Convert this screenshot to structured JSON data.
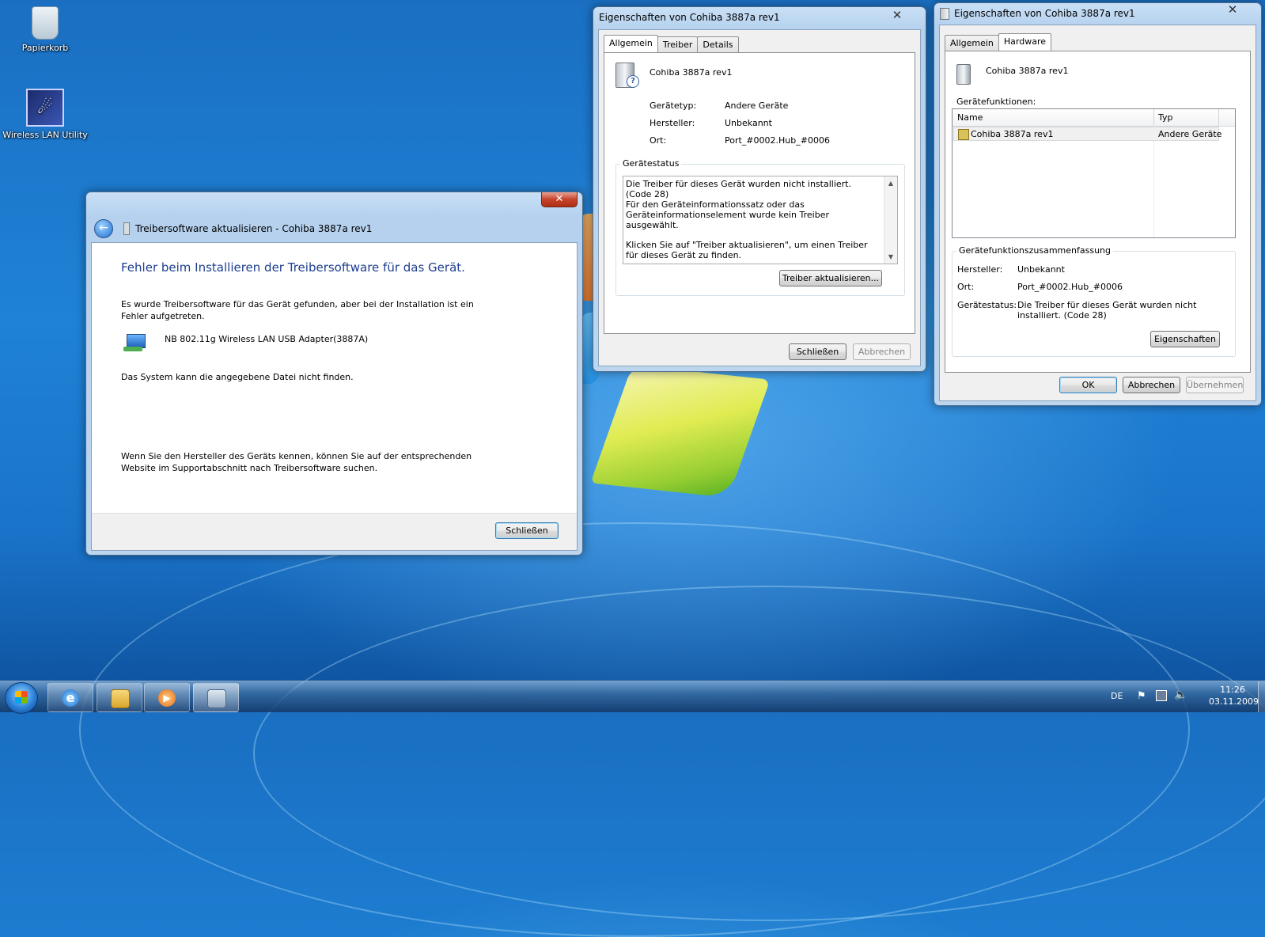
{
  "desktop": {
    "icons": [
      {
        "label": "Papierkorb",
        "icon": "recycle-bin-icon"
      },
      {
        "label": "Wireless LAN Utility",
        "icon": "wireless-lan-utility-icon"
      }
    ]
  },
  "update_dialog": {
    "title": "Treibersoftware aktualisieren - Cohiba 3887a rev1",
    "heading": "Fehler beim Installieren der Treibersoftware für das Gerät.",
    "message": "Es wurde Treibersoftware für das Gerät gefunden, aber bei der Installation ist ein Fehler aufgetreten.",
    "device_name": "NB 802.11g Wireless LAN USB Adapter(3887A)",
    "error": "Das System kann die angegebene Datei nicht finden.",
    "hint": "Wenn Sie den Hersteller des Geräts kennen, können Sie auf der entsprechenden Website im Supportabschnitt nach Treibersoftware suchen.",
    "close_label": "Schließen",
    "close_x": "✕"
  },
  "props_dialog": {
    "title": "Eigenschaften von Cohiba 3887a rev1",
    "tabs": [
      "Allgemein",
      "Treiber",
      "Details"
    ],
    "device_name": "Cohiba 3887a rev1",
    "fields": [
      {
        "label": "Gerätetyp:",
        "value": "Andere Geräte"
      },
      {
        "label": "Hersteller:",
        "value": "Unbekannt"
      },
      {
        "label": "Ort:",
        "value": "Port_#0002.Hub_#0006"
      }
    ],
    "status_group": "Gerätestatus",
    "status_lines": [
      "Die Treiber für dieses Gerät wurden nicht installiert. (Code 28)",
      "Für den Geräteinformationssatz oder das Geräteinformationselement wurde kein Treiber ausgewählt.",
      "Klicken Sie auf \"Treiber aktualisieren\", um einen Treiber für dieses Gerät zu finden."
    ],
    "update_driver_label": "Treiber aktualisieren...",
    "close_label": "Schließen",
    "cancel_label": "Abbrechen",
    "close_x": "✕"
  },
  "hw_dialog": {
    "title": "Eigenschaften von Cohiba 3887a rev1",
    "tabs": [
      "Allgemein",
      "Hardware"
    ],
    "device_name": "Cohiba 3887a rev1",
    "functions_label": "Gerätefunktionen:",
    "columns": [
      "Name",
      "Typ"
    ],
    "rows": [
      {
        "name": "Cohiba 3887a rev1",
        "type": "Andere Geräte"
      }
    ],
    "summary_group": "Gerätefunktionszusammenfassung",
    "summary": [
      {
        "label": "Hersteller:",
        "value": "Unbekannt"
      },
      {
        "label": "Ort:",
        "value": "Port_#0002.Hub_#0006"
      },
      {
        "label": "Gerätestatus:",
        "value": "Die Treiber für dieses Gerät wurden nicht installiert. (Code 28)"
      }
    ],
    "properties_label": "Eigenschaften",
    "ok_label": "OK",
    "cancel_label": "Abbrechen",
    "apply_label": "Übernehmen",
    "close_x": "✕"
  },
  "taskbar": {
    "language": "DE",
    "time": "11:26",
    "date": "03.11.2009",
    "pinned": [
      "internet-explorer-icon",
      "windows-explorer-icon",
      "media-player-icon",
      "device-manager-icon"
    ]
  }
}
